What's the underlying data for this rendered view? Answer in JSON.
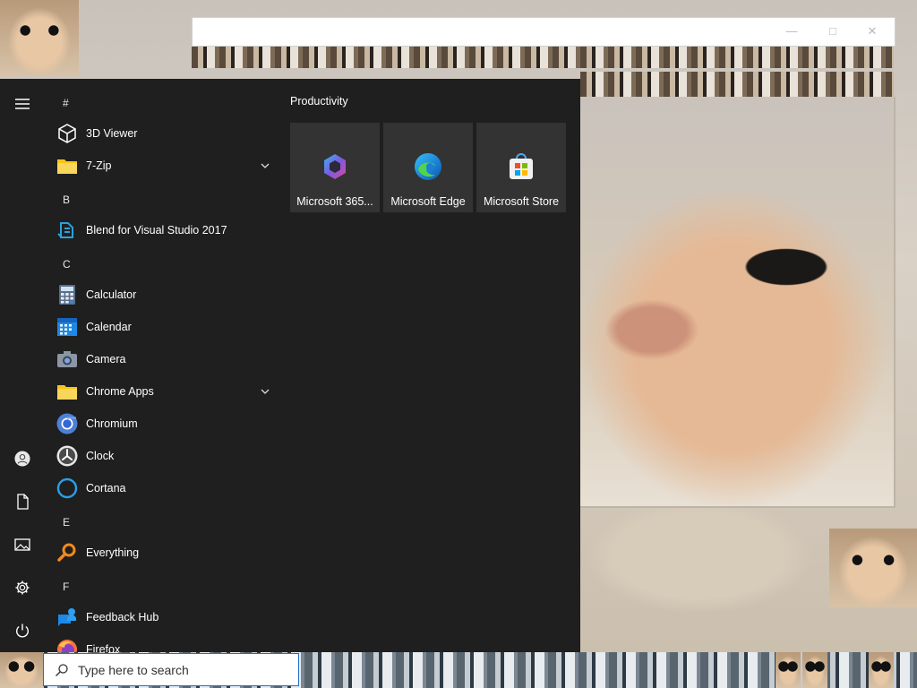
{
  "start_menu": {
    "letters": {
      "hash": "#",
      "b": "B",
      "c": "C",
      "e": "E",
      "f": "F"
    },
    "apps": [
      {
        "label": "3D Viewer",
        "icon": "cube-icon"
      },
      {
        "label": "7-Zip",
        "icon": "folder-icon",
        "expandable": true
      },
      {
        "label": "Blend for Visual Studio 2017",
        "icon": "blend-icon"
      },
      {
        "label": "Calculator",
        "icon": "calculator-icon"
      },
      {
        "label": "Calendar",
        "icon": "calendar-icon"
      },
      {
        "label": "Camera",
        "icon": "camera-icon"
      },
      {
        "label": "Chrome Apps",
        "icon": "folder-icon",
        "expandable": true
      },
      {
        "label": "Chromium",
        "icon": "chromium-icon"
      },
      {
        "label": "Clock",
        "icon": "clock-icon"
      },
      {
        "label": "Cortana",
        "icon": "cortana-icon"
      },
      {
        "label": "Everything",
        "icon": "magnifier-icon"
      },
      {
        "label": "Feedback Hub",
        "icon": "feedback-icon"
      },
      {
        "label": "Firefox",
        "icon": "firefox-icon"
      }
    ],
    "rail": [
      "hamburger-icon",
      "user-icon",
      "document-icon",
      "pictures-icon",
      "settings-icon",
      "power-icon"
    ],
    "tile_group": {
      "title": "Productivity",
      "tiles": [
        {
          "label": "Microsoft 365...",
          "icon": "microsoft-365-icon"
        },
        {
          "label": "Microsoft Edge",
          "icon": "edge-icon"
        },
        {
          "label": "Microsoft Store",
          "icon": "store-icon"
        }
      ]
    }
  },
  "taskbar": {
    "search": {
      "placeholder": "Type here to search"
    }
  },
  "colors": {
    "start_bg": "#1f1f1f",
    "tile_bg": "#333333",
    "folder": "#f5c518",
    "accent_blue": "#1f6fc5"
  }
}
